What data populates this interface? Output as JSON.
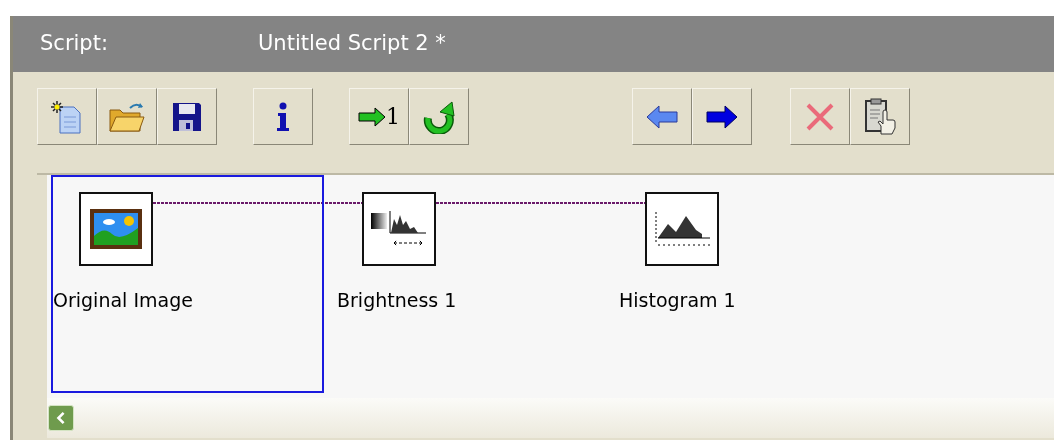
{
  "header": {
    "label": "Script:",
    "title": "Untitled Script 2 *"
  },
  "toolbar": [
    {
      "buttons": [
        {
          "kind": "new"
        },
        {
          "kind": "open"
        },
        {
          "kind": "save"
        }
      ]
    },
    {
      "buttons": [
        {
          "kind": "info"
        }
      ]
    },
    {
      "buttons": [
        {
          "kind": "step",
          "label": "1"
        },
        {
          "kind": "run"
        }
      ]
    },
    {
      "buttons": [
        {
          "kind": "back"
        },
        {
          "kind": "forward"
        }
      ]
    },
    {
      "buttons": [
        {
          "kind": "delete"
        },
        {
          "kind": "clipboard"
        }
      ]
    }
  ],
  "steps": [
    {
      "name": "Original Image",
      "kind": "image",
      "selected": true
    },
    {
      "name": "Brightness 1",
      "kind": "brightness",
      "selected": false
    },
    {
      "name": "Histogram 1",
      "kind": "histogram",
      "selected": false
    }
  ]
}
